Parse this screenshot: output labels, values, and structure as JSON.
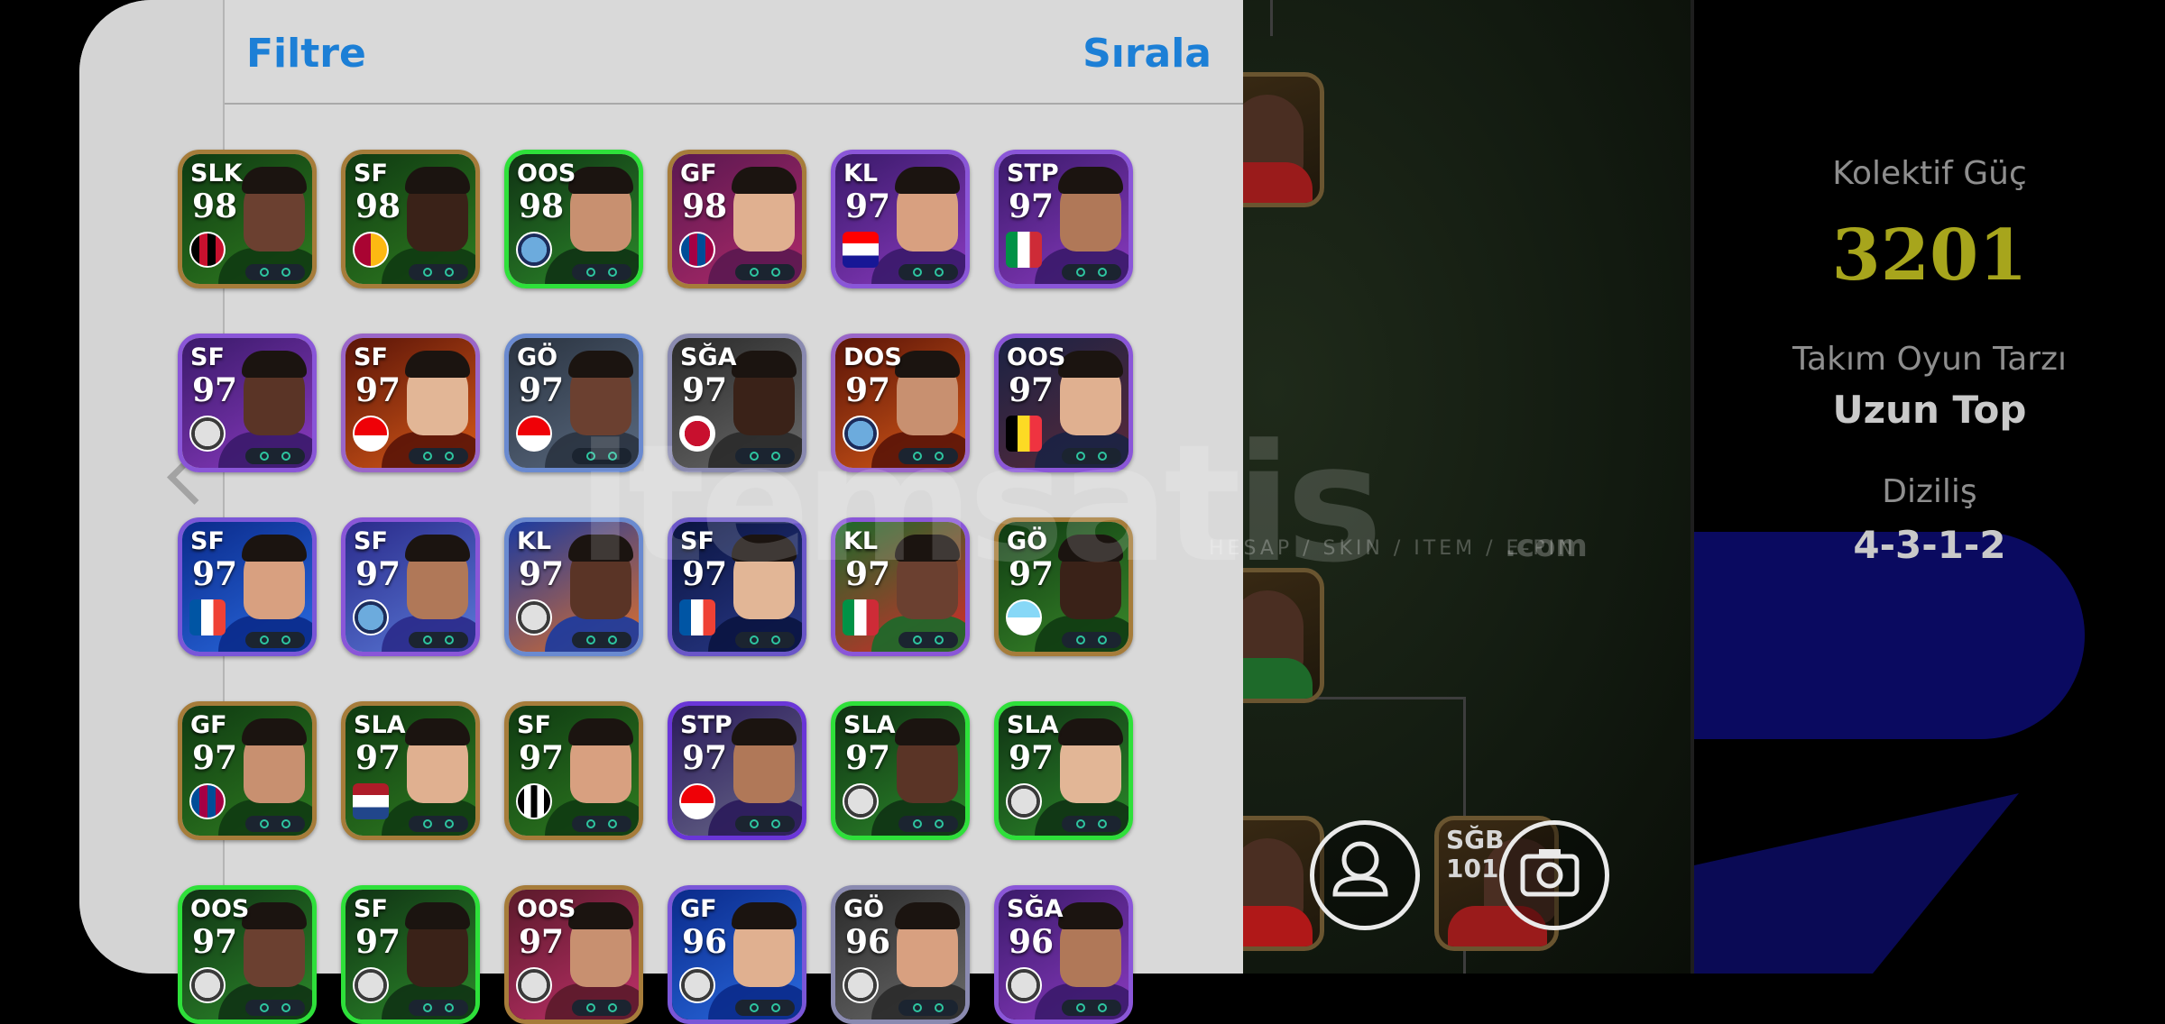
{
  "header": {
    "filter_label": "Filtre",
    "sort_label": "Sırala"
  },
  "stats": {
    "collective_power_label": "Kolektif Güç",
    "collective_power_value": "3201",
    "team_style_label": "Takım Oyun Tarzı",
    "team_style_value": "Uzun Top",
    "formation_label": "Diziliş",
    "formation_value": "4-3-1-2"
  },
  "pitch_cards": [
    {
      "pos": "",
      "rating": ""
    },
    {
      "pos": "",
      "rating": ""
    },
    {
      "pos": "",
      "rating": ""
    },
    {
      "pos": "SĞB",
      "rating": "101"
    }
  ],
  "watermark": {
    "main": "itemsatis",
    "sub": "HESAP / SKIN / ITEM / E-PIN",
    "domain": ".com"
  },
  "colors": {
    "accent": "#1c7fd6",
    "gold": "#a7a51c"
  },
  "players": [
    {
      "pos": "SLK",
      "rating": "98",
      "badge": "club-milan",
      "theme": "green"
    },
    {
      "pos": "SF",
      "rating": "98",
      "badge": "club-galatasaray",
      "theme": "green"
    },
    {
      "pos": "OOS",
      "rating": "98",
      "badge": "club-mancity",
      "theme": "green-neon"
    },
    {
      "pos": "GF",
      "rating": "98",
      "badge": "club-barcelona",
      "theme": "purple-gold"
    },
    {
      "pos": "KL",
      "rating": "97",
      "badge": "flag-croatia",
      "theme": "purple"
    },
    {
      "pos": "STP",
      "rating": "97",
      "badge": "flag-italy",
      "theme": "purple"
    },
    {
      "pos": "SF",
      "rating": "97",
      "badge": "club-generic",
      "theme": "purple"
    },
    {
      "pos": "SF",
      "rating": "97",
      "badge": "club-arsenal",
      "theme": "fire"
    },
    {
      "pos": "GÖ",
      "rating": "97",
      "badge": "club-arsenal",
      "theme": "grey-blue"
    },
    {
      "pos": "SĞA",
      "rating": "97",
      "badge": "club-liverpool",
      "theme": "grey"
    },
    {
      "pos": "DOS",
      "rating": "97",
      "badge": "club-mancity",
      "theme": "fire"
    },
    {
      "pos": "OOS",
      "rating": "97",
      "badge": "flag-belgium",
      "theme": "blue-dark"
    },
    {
      "pos": "SF",
      "rating": "97",
      "badge": "flag-france",
      "theme": "blue"
    },
    {
      "pos": "SF",
      "rating": "97",
      "badge": "club-mancity",
      "theme": "purple-blue"
    },
    {
      "pos": "KL",
      "rating": "97",
      "badge": "club-generic",
      "theme": "blue-orange"
    },
    {
      "pos": "SF",
      "rating": "97",
      "badge": "flag-france",
      "theme": "navy"
    },
    {
      "pos": "KL",
      "rating": "97",
      "badge": "flag-italy",
      "theme": "italy"
    },
    {
      "pos": "GÖ",
      "rating": "97",
      "badge": "club-lazio",
      "theme": "green-gold"
    },
    {
      "pos": "GF",
      "rating": "97",
      "badge": "club-barcelona",
      "theme": "green"
    },
    {
      "pos": "SLA",
      "rating": "97",
      "badge": "flag-netherlands",
      "theme": "green"
    },
    {
      "pos": "SF",
      "rating": "97",
      "badge": "club-santos",
      "theme": "green"
    },
    {
      "pos": "STP",
      "rating": "97",
      "badge": "club-arsenal",
      "theme": "purple-dark"
    },
    {
      "pos": "SLA",
      "rating": "97",
      "badge": "club-generic",
      "theme": "green-neon"
    },
    {
      "pos": "SLA",
      "rating": "97",
      "badge": "club-generic",
      "theme": "green-neon"
    },
    {
      "pos": "OOS",
      "rating": "97",
      "badge": "club-generic",
      "theme": "green-neon"
    },
    {
      "pos": "SF",
      "rating": "97",
      "badge": "club-generic",
      "theme": "green-neon"
    },
    {
      "pos": "OOS",
      "rating": "97",
      "badge": "club-generic",
      "theme": "red-gold"
    },
    {
      "pos": "GF",
      "rating": "96",
      "badge": "club-generic",
      "theme": "blue"
    },
    {
      "pos": "GÖ",
      "rating": "96",
      "badge": "club-generic",
      "theme": "grey"
    },
    {
      "pos": "SĞA",
      "rating": "96",
      "badge": "club-generic",
      "theme": "purple"
    }
  ]
}
